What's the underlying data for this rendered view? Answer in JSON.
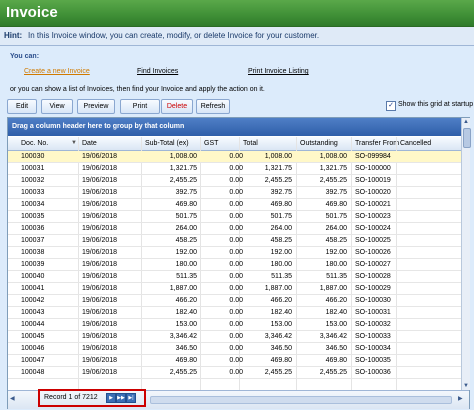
{
  "window": {
    "title": "Invoice"
  },
  "hint": {
    "label": "Hint:",
    "text": "In this Invoice window, you can create, modify, or delete Invoice for your customer."
  },
  "actions": {
    "you_can": "You can:",
    "create": "Create a new Invoice",
    "find": "Find Invoices",
    "print_listing": "Print Invoice Listing",
    "instruction": "or you can show a list of Invoices, then find your Invoice and apply the action on it."
  },
  "toolbar": {
    "edit": "Edit",
    "view": "View",
    "preview": "Preview",
    "print": "Print",
    "delete": "Delete",
    "refresh": "Refresh",
    "show_grid_label": "Show this grid at startup",
    "show_grid_checked": "✓"
  },
  "grid": {
    "group_hint": "Drag a column header here to group by that column",
    "columns": {
      "doc_no": "Doc. No.",
      "date": "Date",
      "subtotal": "Sub-Total (ex)",
      "gst": "GST",
      "total": "Total",
      "outstanding": "Outstanding",
      "transfer_from": "Transfer From",
      "cancelled": "Cancelled"
    },
    "rows": [
      [
        "100030",
        "19/06/2018",
        "1,008.00",
        "0.00",
        "1,008.00",
        "1,008.00",
        "SO-099984"
      ],
      [
        "100031",
        "19/06/2018",
        "1,321.75",
        "0.00",
        "1,321.75",
        "1,321.75",
        "SO-100000"
      ],
      [
        "100032",
        "19/06/2018",
        "2,455.25",
        "0.00",
        "2,455.25",
        "2,455.25",
        "SO-100019"
      ],
      [
        "100033",
        "19/06/2018",
        "392.75",
        "0.00",
        "392.75",
        "392.75",
        "SO-100020"
      ],
      [
        "100034",
        "19/06/2018",
        "469.80",
        "0.00",
        "469.80",
        "469.80",
        "SO-100021"
      ],
      [
        "100035",
        "19/06/2018",
        "501.75",
        "0.00",
        "501.75",
        "501.75",
        "SO-100023"
      ],
      [
        "100036",
        "19/06/2018",
        "264.00",
        "0.00",
        "264.00",
        "264.00",
        "SO-100024"
      ],
      [
        "100037",
        "19/06/2018",
        "458.25",
        "0.00",
        "458.25",
        "458.25",
        "SO-100025"
      ],
      [
        "100038",
        "19/06/2018",
        "192.00",
        "0.00",
        "192.00",
        "192.00",
        "SO-100026"
      ],
      [
        "100039",
        "19/06/2018",
        "180.00",
        "0.00",
        "180.00",
        "180.00",
        "SO-100027"
      ],
      [
        "100040",
        "19/06/2018",
        "511.35",
        "0.00",
        "511.35",
        "511.35",
        "SO-100028"
      ],
      [
        "100041",
        "19/06/2018",
        "1,887.00",
        "0.00",
        "1,887.00",
        "1,887.00",
        "SO-100029"
      ],
      [
        "100042",
        "19/06/2018",
        "466.20",
        "0.00",
        "466.20",
        "466.20",
        "SO-100030"
      ],
      [
        "100043",
        "19/06/2018",
        "182.40",
        "0.00",
        "182.40",
        "182.40",
        "SO-100031"
      ],
      [
        "100044",
        "19/06/2018",
        "153.00",
        "0.00",
        "153.00",
        "153.00",
        "SO-100032"
      ],
      [
        "100045",
        "19/06/2018",
        "3,346.42",
        "0.00",
        "3,346.42",
        "3,346.42",
        "SO-100033"
      ],
      [
        "100046",
        "19/06/2018",
        "346.50",
        "0.00",
        "346.50",
        "346.50",
        "SO-100034"
      ],
      [
        "100047",
        "19/06/2018",
        "469.80",
        "0.00",
        "469.80",
        "469.80",
        "SO-100035"
      ],
      [
        "100048",
        "19/06/2018",
        "2,455.25",
        "0.00",
        "2,455.25",
        "2,455.25",
        "SO-100036"
      ]
    ]
  },
  "pager": {
    "record_text": "Record 1 of 7212"
  }
}
